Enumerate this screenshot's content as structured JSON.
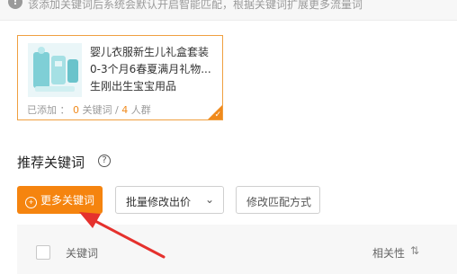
{
  "notice": {
    "text": "该添加关键词后系统会默认开启智能匹配，根据关键词扩展更多流量词",
    "icon": "info-icon"
  },
  "product": {
    "title_lines": [
      "婴儿衣服新生儿礼盒套装",
      "0-3个月6春夏满月礼物...",
      "生刚出生宝宝用品"
    ],
    "added_label": "已添加 ：",
    "keyword_count": "0",
    "keyword_unit": "关键词",
    "separator": " / ",
    "crowd_count": "4",
    "crowd_unit": "人群",
    "selected_icon": "check-icon"
  },
  "section": {
    "title": "推荐关键词",
    "help_icon": "question-circle-icon"
  },
  "toolbar": {
    "more_keywords": "更多关键词",
    "batch_modify_bid": "批量修改出价",
    "modify_match": "修改匹配方式"
  },
  "table": {
    "columns": {
      "keyword": "关键词",
      "relevance": "相关性"
    }
  },
  "colors": {
    "accent": "#f5840f",
    "border_selected": "#f0a040",
    "arrow": "#e5312d"
  }
}
